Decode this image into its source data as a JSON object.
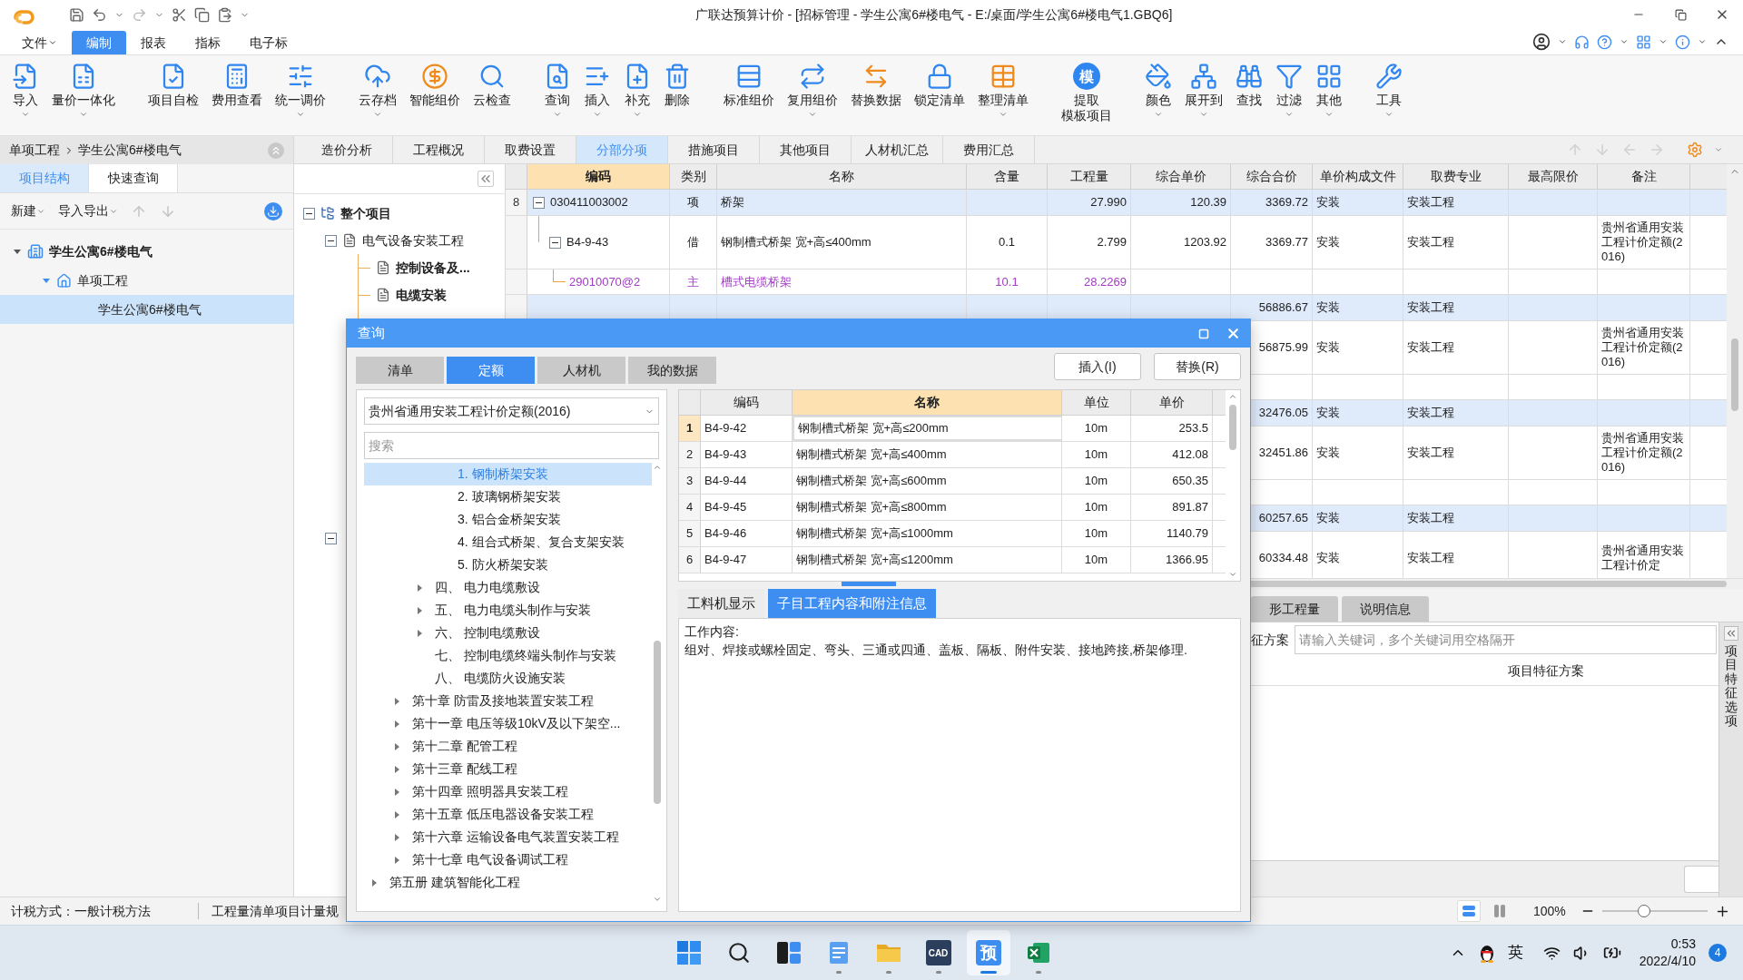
{
  "title_bar": {
    "title": "广联达预算计价 - [招标管理 - 学生公寓6#楼电气 - E:/桌面/学生公寓6#楼电气1.GBQ6]"
  },
  "menu": [
    {
      "label": "文件",
      "dropdown": true,
      "selected": false
    },
    {
      "label": "编制",
      "dropdown": false,
      "selected": true
    },
    {
      "label": "报表",
      "dropdown": false,
      "selected": false
    },
    {
      "label": "指标",
      "dropdown": false,
      "selected": false
    },
    {
      "label": "电子标",
      "dropdown": false,
      "selected": false
    }
  ],
  "ribbon": {
    "groups": [
      [
        {
          "lines": [
            "导入"
          ],
          "dropdown": true
        },
        {
          "lines": [
            "量价一体化"
          ],
          "dropdown": true
        }
      ],
      [
        {
          "lines": [
            "项目自检"
          ],
          "dropdown": false
        },
        {
          "lines": [
            "费用查看"
          ],
          "dropdown": false
        },
        {
          "lines": [
            "统一调价"
          ],
          "dropdown": true
        }
      ],
      [
        {
          "lines": [
            "云存档"
          ],
          "dropdown": true
        },
        {
          "lines": [
            "智能组价"
          ],
          "dropdown": false
        },
        {
          "lines": [
            "云检查"
          ],
          "dropdown": false
        }
      ],
      [
        {
          "lines": [
            "查询"
          ],
          "dropdown": true
        },
        {
          "lines": [
            "插入"
          ],
          "dropdown": true
        },
        {
          "lines": [
            "补充"
          ],
          "dropdown": true
        },
        {
          "lines": [
            "删除"
          ],
          "dropdown": false
        }
      ],
      [
        {
          "lines": [
            "标准组价"
          ],
          "dropdown": false
        },
        {
          "lines": [
            "复用组价"
          ],
          "dropdown": true
        },
        {
          "lines": [
            "替换数据"
          ],
          "dropdown": false
        },
        {
          "lines": [
            "锁定清单"
          ],
          "dropdown": false
        },
        {
          "lines": [
            "整理清单"
          ],
          "dropdown": true
        }
      ],
      [
        {
          "lines": [
            "提取",
            "模板项目"
          ],
          "dropdown": false,
          "glyph": "模"
        }
      ],
      [
        {
          "lines": [
            "颜色"
          ],
          "dropdown": true
        },
        {
          "lines": [
            "展开到"
          ],
          "dropdown": true
        },
        {
          "lines": [
            "查找"
          ],
          "dropdown": false
        },
        {
          "lines": [
            "过滤"
          ],
          "dropdown": true
        },
        {
          "lines": [
            "其他"
          ],
          "dropdown": true
        }
      ],
      [
        {
          "lines": [
            "工具"
          ],
          "dropdown": true
        }
      ]
    ]
  },
  "left_panel": {
    "breadcrumb": [
      "单项工程",
      "学生公寓6#楼电气"
    ],
    "tabs": [
      {
        "label": "项目结构",
        "selected": true
      },
      {
        "label": "快速查询",
        "selected": false
      }
    ],
    "toolbar": [
      {
        "label": "新建",
        "dropdown": true
      },
      {
        "label": "导入导出",
        "dropdown": true
      }
    ],
    "tree": [
      {
        "label": "学生公寓6#楼电气",
        "kind": "building",
        "selected": false,
        "expanded": true,
        "children": [
          {
            "label": "单项工程",
            "kind": "house",
            "selected": false,
            "expanded": true,
            "children": [
              {
                "label": "学生公寓6#楼电气",
                "selected": true
              }
            ]
          }
        ]
      }
    ]
  },
  "doc_tabs": [
    {
      "label": "造价分析",
      "selected": false
    },
    {
      "label": "工程概况",
      "selected": false
    },
    {
      "label": "取费设置",
      "selected": false
    },
    {
      "label": "分部分项",
      "selected": true
    },
    {
      "label": "措施项目",
      "selected": false
    },
    {
      "label": "其他项目",
      "selected": false
    },
    {
      "label": "人材机汇总",
      "selected": false
    },
    {
      "label": "费用汇总",
      "selected": false
    }
  ],
  "outline": [
    {
      "label": "整个项目",
      "kind": "root",
      "expanded": true,
      "children": [
        {
          "label": "电气设备安装工程",
          "kind": "doc",
          "expanded": true,
          "children": [
            {
              "label": "控制设备及...",
              "kind": "doc"
            },
            {
              "label": "电缆安装",
              "kind": "doc"
            }
          ]
        },
        {
          "expanded": true
        }
      ]
    }
  ],
  "table": {
    "columns": [
      {
        "label": "编码",
        "highlighted": true
      },
      {
        "label": "类别",
        "highlighted": false
      },
      {
        "label": "名称",
        "highlighted": false
      },
      {
        "label": "含量",
        "highlighted": false
      },
      {
        "label": "工程量",
        "highlighted": false
      },
      {
        "label": "综合单价",
        "highlighted": false
      },
      {
        "label": "综合合价",
        "highlighted": false
      },
      {
        "label": "单价构成文件",
        "highlighted": false
      },
      {
        "label": "取费专业",
        "highlighted": false
      },
      {
        "label": "最高限价",
        "highlighted": false
      },
      {
        "label": "备注",
        "highlighted": false
      }
    ],
    "rows": [
      {
        "kind": "item",
        "number": "8",
        "expanded": true,
        "code": "030411003002",
        "category": "项",
        "name": "桥架",
        "quantity": "27.990",
        "unit_price": "120.39",
        "total": "3369.72",
        "price_file": "安装",
        "fee_type": "安装工程"
      },
      {
        "kind": "sub",
        "expanded": true,
        "code": "B4-9-43",
        "category": "借",
        "name": "钢制槽式桥架 宽+高≤400mm",
        "content": "0.1",
        "quantity": "2.799",
        "unit_price": "1203.92",
        "total": "3369.77",
        "price_file": "安装",
        "fee_type": "安装工程",
        "remark": "贵州省通用安装工程计价定额(2016)"
      },
      {
        "kind": "material",
        "code": "29010070@2",
        "category": "主",
        "name": "槽式电缆桥架",
        "content": "10.1",
        "quantity": "28.2269"
      },
      {
        "kind": "item",
        "total": "56886.67",
        "price_file": "安装",
        "fee_type": "安装工程"
      },
      {
        "kind": "sub",
        "total": "56875.99",
        "price_file": "安装",
        "fee_type": "安装工程",
        "remark": "贵州省通用安装工程计价定额(2016)"
      },
      {
        "kind": "material"
      },
      {
        "kind": "item",
        "total": "32476.05",
        "price_file": "安装",
        "fee_type": "安装工程"
      },
      {
        "kind": "sub",
        "total": "32451.86",
        "price_file": "安装",
        "fee_type": "安装工程",
        "remark": "贵州省通用安装工程计价定额(2016)"
      },
      {
        "kind": "material"
      },
      {
        "kind": "item",
        "total": "60257.65",
        "price_file": "安装",
        "fee_type": "安装工程"
      },
      {
        "kind": "sub",
        "total": "60334.48",
        "price_file": "安装",
        "fee_type": "安装工程",
        "remark": "贵州省通用安装工程计价定"
      }
    ]
  },
  "lower_panel": {
    "tabs": [
      {
        "label": "形工程量",
        "selected": false
      },
      {
        "label": "说明信息",
        "selected": false
      }
    ],
    "feature_label": "征方案",
    "feature_search": {
      "placeholder": "请输入关键词，多个关键词用空格隔开"
    },
    "column": "项目特征方案",
    "side_tab": "项目特征选项"
  },
  "status_bar": {
    "items": [
      "计税方式：一般计税方法",
      "工程量清单项目计量规"
    ],
    "view_modes": [
      {
        "selected": true
      },
      {
        "selected": false
      }
    ],
    "zoom": {
      "reading": "100%",
      "level": 0.4
    }
  },
  "dialog": {
    "title": "查询",
    "tabs": [
      {
        "label": "清单",
        "selected": false
      },
      {
        "label": "定额",
        "selected": true
      },
      {
        "label": "人材机",
        "selected": false
      },
      {
        "label": "我的数据",
        "selected": false
      }
    ],
    "buttons": [
      "插入(I)",
      "替换(R)"
    ],
    "library": "贵州省通用安装工程计价定额(2016)",
    "search": {
      "placeholder": "搜索"
    },
    "tree": [
      {
        "children": [
          {
            "children": [
              {
                "children": [
                  {
                    "label": "1. 钢制桥架安装",
                    "expandable": false,
                    "selected": true
                  },
                  {
                    "label": "2. 玻璃钢桥架安装",
                    "expandable": false,
                    "selected": false
                  },
                  {
                    "label": "3. 铝合金桥架安装",
                    "expandable": false,
                    "selected": false
                  },
                  {
                    "label": "4. 组合式桥架、复合支架安装",
                    "expandable": false,
                    "selected": false
                  },
                  {
                    "label": "5. 防火桥架安装",
                    "expandable": false,
                    "selected": false
                  }
                ]
              },
              {
                "label": "四、 电力电缆敷设",
                "expandable": true,
                "selected": false
              },
              {
                "label": "五、 电力电缆头制作与安装",
                "expandable": true,
                "selected": false
              },
              {
                "label": "六、 控制电缆敷设",
                "expandable": true,
                "selected": false
              },
              {
                "label": "七、 控制电缆终端头制作与安装",
                "expandable": false,
                "selected": false
              },
              {
                "label": "八、 电缆防火设施安装",
                "expandable": false,
                "selected": false
              }
            ]
          },
          {
            "label": "第十章 防雷及接地装置安装工程",
            "expandable": true,
            "selected": false
          },
          {
            "label": "第十一章 电压等级10kV及以下架空...",
            "expandable": true,
            "selected": false
          },
          {
            "label": "第十二章 配管工程",
            "expandable": true,
            "selected": false
          },
          {
            "label": "第十三章 配线工程",
            "expandable": true,
            "selected": false
          },
          {
            "label": "第十四章 照明器具安装工程",
            "expandable": true,
            "selected": false
          },
          {
            "label": "第十五章 低压电器设备安装工程",
            "expandable": true,
            "selected": false
          },
          {
            "label": "第十六章 运输设备电气装置安装工程",
            "expandable": true,
            "selected": false
          },
          {
            "label": "第十七章 电气设备调试工程",
            "expandable": true,
            "selected": false
          }
        ]
      },
      {
        "label": "第五册 建筑智能化工程",
        "expandable": true,
        "selected": false
      }
    ],
    "grid": {
      "columns": [
        {
          "label": "编码",
          "highlighted": false
        },
        {
          "label": "名称",
          "highlighted": true
        },
        {
          "label": "单位",
          "highlighted": false
        },
        {
          "label": "单价",
          "highlighted": false
        }
      ],
      "rows": [
        {
          "number": "1",
          "code": "B4-9-42",
          "name": "钢制槽式桥架 宽+高≤200mm",
          "unit": "10m",
          "price": "253.5",
          "selected": true
        },
        {
          "number": "2",
          "code": "B4-9-43",
          "name": "钢制槽式桥架 宽+高≤400mm",
          "unit": "10m",
          "price": "412.08",
          "selected": false
        },
        {
          "number": "3",
          "code": "B4-9-44",
          "name": "钢制槽式桥架 宽+高≤600mm",
          "unit": "10m",
          "price": "650.35",
          "selected": false
        },
        {
          "number": "4",
          "code": "B4-9-45",
          "name": "钢制槽式桥架 宽+高≤800mm",
          "unit": "10m",
          "price": "891.87",
          "selected": false
        },
        {
          "number": "5",
          "code": "B4-9-46",
          "name": "钢制槽式桥架 宽+高≤1000mm",
          "unit": "10m",
          "price": "1140.79",
          "selected": false
        },
        {
          "number": "6",
          "code": "B4-9-47",
          "name": "钢制槽式桥架 宽+高≤1200mm",
          "unit": "10m",
          "price": "1366.95",
          "selected": false
        }
      ]
    },
    "detail_tabs": [
      {
        "label": "工料机显示",
        "selected": false
      },
      {
        "label": "子目工程内容和附注信息",
        "selected": true
      }
    ],
    "detail": {
      "heading": "工作内容:",
      "text": "组对、焊接或螺栓固定、弯头、三通或四通、盖板、隔板、附件安装、接地跨接,桥架修理."
    }
  },
  "taskbar": {
    "apps": [
      {
        "kind": "start",
        "running": false,
        "active": false
      },
      {
        "kind": "search",
        "running": false,
        "active": false
      },
      {
        "kind": "snap",
        "running": false,
        "active": false
      },
      {
        "kind": "notes",
        "running": true,
        "active": false
      },
      {
        "kind": "folder",
        "running": true,
        "active": false
      },
      {
        "kind": "cad",
        "glyph": "CAD",
        "running": true,
        "active": false
      },
      {
        "kind": "app",
        "glyph": "预",
        "running": true,
        "active": true
      },
      {
        "kind": "excel",
        "running": true,
        "active": false
      }
    ],
    "tray": {
      "ime": "英",
      "time": "0:53",
      "date": "2022/4/10",
      "badge": "4"
    }
  }
}
